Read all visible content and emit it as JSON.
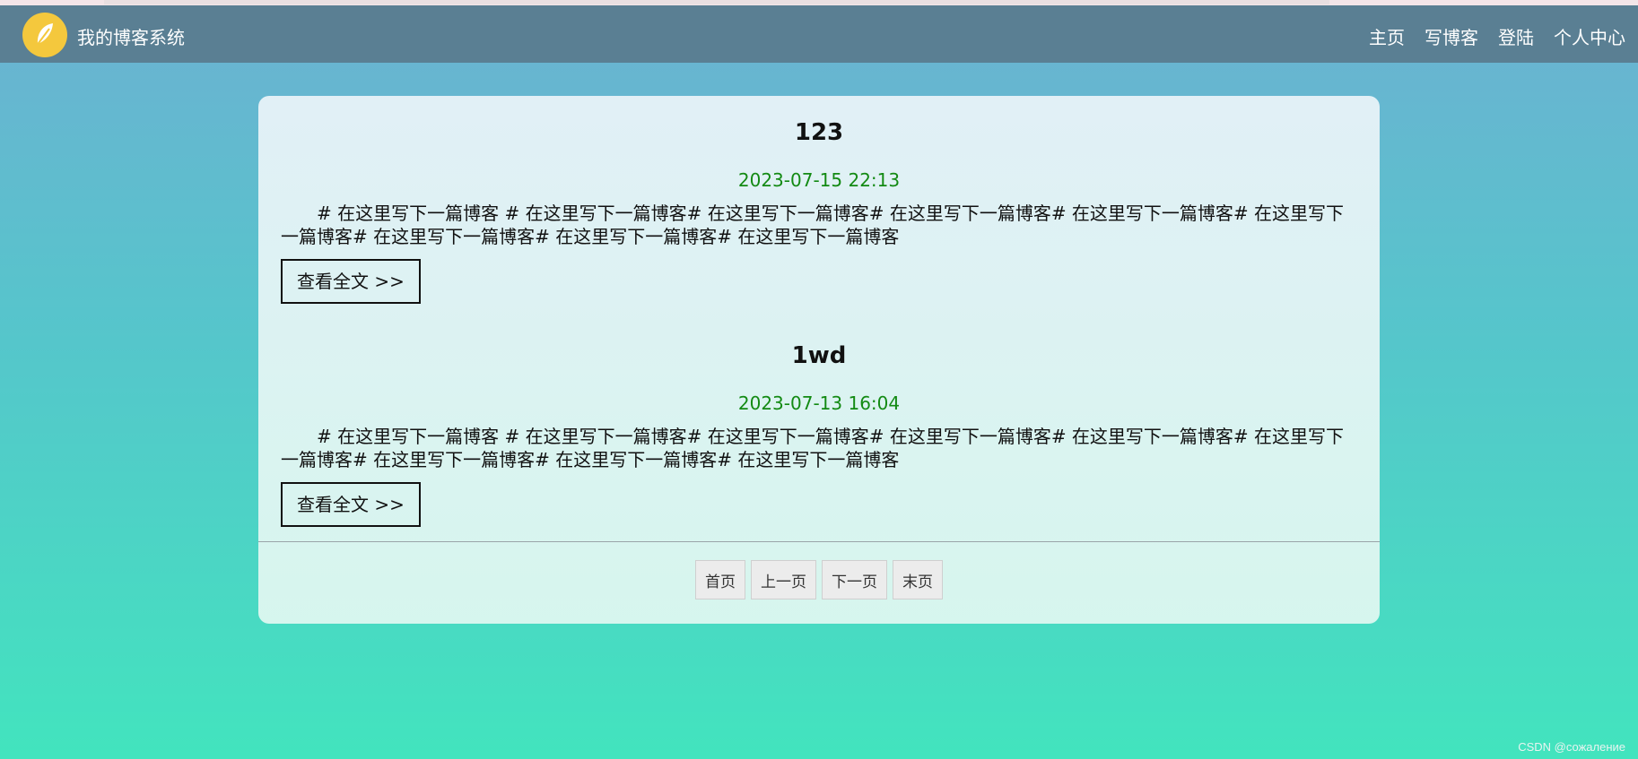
{
  "nav": {
    "brand": "我的博客系统",
    "links": [
      "主页",
      "写博客",
      "登陆",
      "个人中心"
    ]
  },
  "posts": [
    {
      "title": "123",
      "date": "2023-07-15 22:13",
      "body": "# 在这里写下一篇博客 # 在这里写下一篇博客# 在这里写下一篇博客# 在这里写下一篇博客# 在这里写下一篇博客# 在这里写下一篇博客# 在这里写下一篇博客# 在这里写下一篇博客# 在这里写下一篇博客",
      "more": "查看全文 >>"
    },
    {
      "title": "1wd",
      "date": "2023-07-13 16:04",
      "body": "# 在这里写下一篇博客 # 在这里写下一篇博客# 在这里写下一篇博客# 在这里写下一篇博客# 在这里写下一篇博客# 在这里写下一篇博客# 在这里写下一篇博客# 在这里写下一篇博客# 在这里写下一篇博客",
      "more": "查看全文 >>"
    }
  ],
  "pager": {
    "first": "首页",
    "prev": "上一页",
    "next": "下一页",
    "last": "末页"
  },
  "watermark": "CSDN @сожаление",
  "colors": {
    "nav_bg": "#5a7f93",
    "date": "#138a13",
    "logo": "#f4c83d"
  }
}
